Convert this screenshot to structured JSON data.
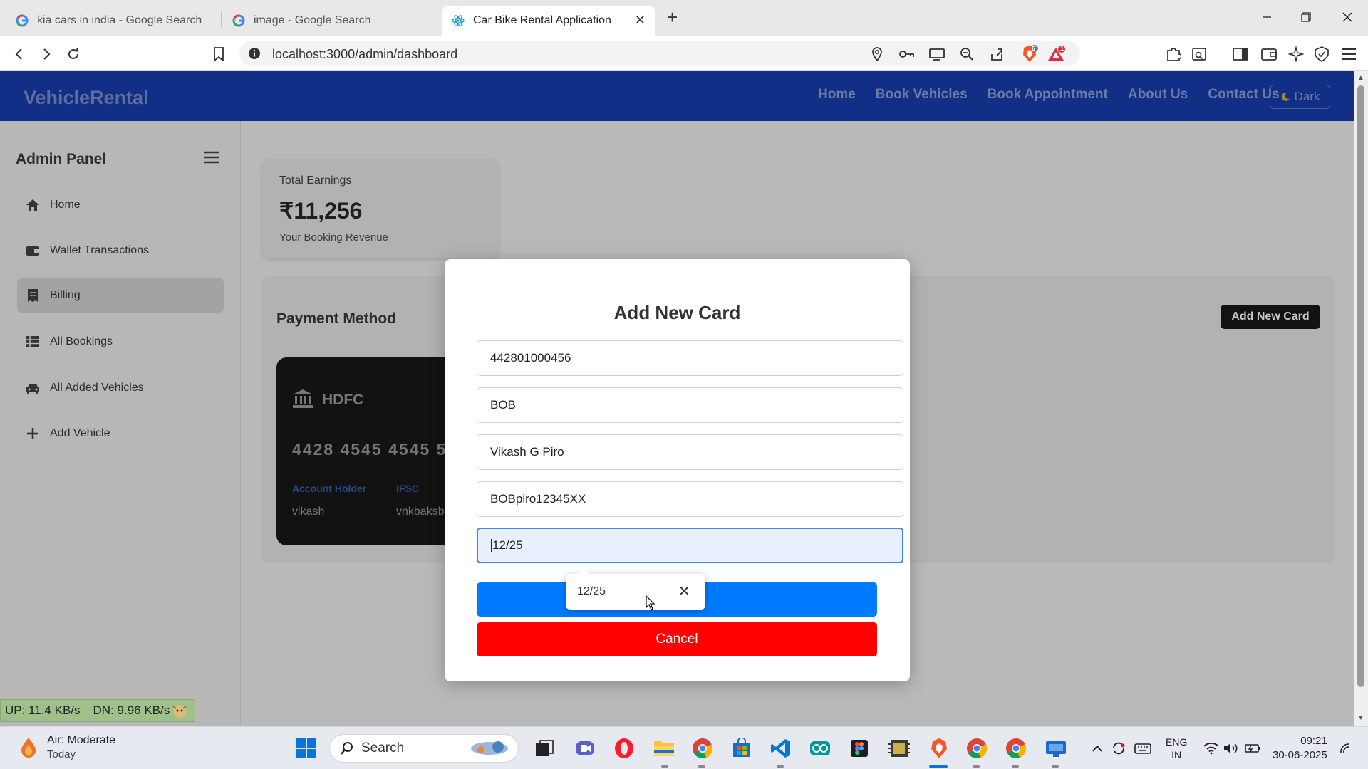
{
  "browser": {
    "tabs": [
      {
        "title": "kia cars in india - Google Search"
      },
      {
        "title": "image - Google Search"
      },
      {
        "title": "Car Bike Rental Application"
      }
    ],
    "url": "localhost:3000/admin/dashboard",
    "brave_badge": "6",
    "rewards_badge": "1"
  },
  "navbar": {
    "brand": "VehicleRental",
    "links": [
      "Home",
      "Book Vehicles",
      "Book Appointment",
      "About Us",
      "Contact Us"
    ],
    "theme_toggle": "Dark"
  },
  "sidebar": {
    "title": "Admin Panel",
    "items": [
      {
        "label": "Home",
        "icon": "home-icon"
      },
      {
        "label": "Wallet Transactions",
        "icon": "wallet-icon"
      },
      {
        "label": "Billing",
        "icon": "receipt-icon",
        "active": true
      },
      {
        "label": "All Bookings",
        "icon": "list-icon"
      },
      {
        "label": "All Added Vehicles",
        "icon": "car-icon"
      },
      {
        "label": "Add Vehicle",
        "icon": "plus-icon"
      }
    ]
  },
  "earnings": {
    "title": "Total Earnings",
    "value": "₹11,256",
    "subtitle": "Your Booking Revenue"
  },
  "payment": {
    "title": "Payment Method",
    "add_button": "Add New Card",
    "card": {
      "bank": "HDFC",
      "number": "4428 4545 4545 5",
      "holder_label": "Account Holder",
      "holder": "vikash",
      "ifsc_label": "IFSC",
      "ifsc": "vnkbaksbd"
    }
  },
  "modal": {
    "title": "Add New Card",
    "fields": {
      "card_number": "442801000456",
      "bank_name": "BOB",
      "holder_name": "Vikash G Piro",
      "ifsc": "BOBpiro12345XX",
      "expiry": "12/25"
    },
    "autofill_suggestion": "12/25",
    "cancel_label": "Cancel"
  },
  "speed_meter": {
    "up": "UP: 11.4 KB/s",
    "down": "DN: 9.96 KB/s"
  },
  "taskbar": {
    "weather_title": "Air: Moderate",
    "weather_sub": "Today",
    "search_placeholder": "Search",
    "lang1": "ENG",
    "lang2": "IN",
    "time": "09:21",
    "date": "30-06-2025"
  }
}
